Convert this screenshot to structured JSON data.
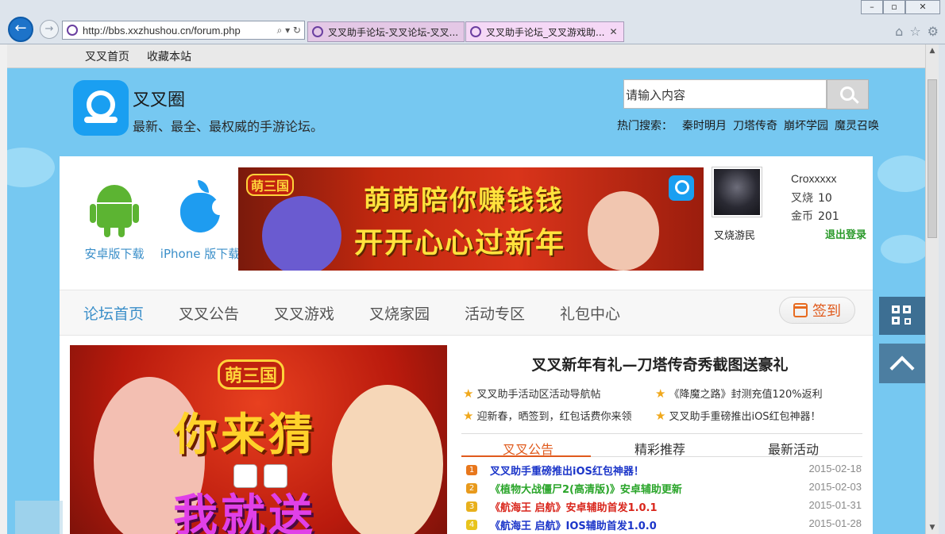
{
  "browser": {
    "url": "http://bbs.xxzhushou.cn/forum.php",
    "tabs": [
      {
        "title": "叉叉助手论坛-叉叉论坛-叉叉..."
      },
      {
        "title": "叉叉助手论坛_叉叉游戏助..."
      }
    ]
  },
  "topbar": {
    "links": [
      "叉叉首页",
      "收藏本站"
    ]
  },
  "header": {
    "site_name": "叉叉圈",
    "slogan": "最新、最全、最权威的手游论坛。",
    "search_placeholder": "请输入内容",
    "hot_label": "热门搜索：",
    "hot_terms": [
      "秦时明月",
      "刀塔传奇",
      "崩坏学园",
      "魔灵召唤"
    ]
  },
  "downloads": {
    "android_label": "安卓版下载",
    "iphone_label": "iPhone 版下载"
  },
  "banner": {
    "logo": "萌三国",
    "line1": "萌萌陪你赚钱钱",
    "line2": "开开心心过新年"
  },
  "user": {
    "name": "Croxxxxx",
    "group": "叉烧游民",
    "stats": [
      {
        "label": "叉烧",
        "value": "10"
      },
      {
        "label": "金币",
        "value": "201"
      }
    ],
    "logout": "退出登录"
  },
  "nav": {
    "items": [
      "论坛首页",
      "叉叉公告",
      "叉叉游戏",
      "叉烧家园",
      "活动专区",
      "礼包中心"
    ],
    "active": 0,
    "signin": "签到"
  },
  "promo": {
    "logo": "萌三国",
    "line1": "你来猜",
    "line2": "我就送"
  },
  "news": {
    "headline": "叉叉新年有礼—刀塔传奇秀截图送豪礼",
    "links": [
      "叉叉助手活动区活动导航帖",
      "《降魔之路》封测充值120%返利",
      "迎新春，晒签到，红包话费你来领",
      "叉叉助手重磅推出iOS红包神器！"
    ],
    "tabs": [
      "叉叉公告",
      "精彩推荐",
      "最新活动"
    ],
    "active_tab": 0,
    "list": [
      {
        "rank": "1",
        "title": "叉叉助手重磅推出iOS红包神器！",
        "date": "2015-02-18",
        "color": "#1b35c9"
      },
      {
        "rank": "2",
        "title": "《植物大战僵尸2(高清版)》安卓辅助更新",
        "date": "2015-02-03",
        "color": "#2aa52a"
      },
      {
        "rank": "3",
        "title": "《航海王 启航》安卓辅助首发1.0.1",
        "date": "2015-01-31",
        "color": "#d9261c"
      },
      {
        "rank": "4",
        "title": "《航海王 启航》IOS辅助首发1.0.0",
        "date": "2015-01-28",
        "color": "#1b35c9"
      }
    ]
  },
  "colors": {
    "accent_blue": "#3b8fc9",
    "accent_orange": "#e05a1c",
    "sky": "#76c8f1"
  }
}
